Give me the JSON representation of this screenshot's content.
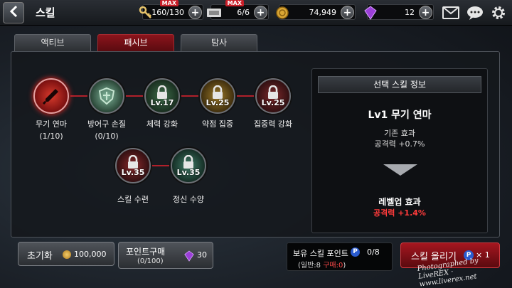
{
  "header": {
    "title": "스킬",
    "resources": [
      {
        "icon": "key-icon",
        "value": "160/130",
        "badge": "MAX"
      },
      {
        "icon": "ticket-icon",
        "value": "6/6",
        "badge": "MAX"
      },
      {
        "icon": "gold-coin-icon",
        "value": "74,949"
      },
      {
        "icon": "purple-gem-icon",
        "value": "12"
      }
    ]
  },
  "tabs": [
    "액티브",
    "패시브",
    "탐사"
  ],
  "active_tab": "패시브",
  "skills": [
    {
      "name": "무기 연마",
      "level": "(1/10)",
      "locked": false,
      "color": "#b3201f"
    },
    {
      "name": "방어구 손질",
      "level": "(0/10)",
      "locked": false,
      "color": "#3e6b4e"
    },
    {
      "name": "체력 강화",
      "lock_level": "Lv.17",
      "locked": true,
      "color": "#2f5c3b"
    },
    {
      "name": "약점 집중",
      "lock_level": "Lv.25",
      "locked": true,
      "color": "#7a5a1c"
    },
    {
      "name": "집중력 강화",
      "lock_level": "Lv.25",
      "locked": true,
      "color": "#6a1f22"
    },
    {
      "name": "스킬 수련",
      "lock_level": "Lv.35",
      "locked": true,
      "color": "#6a1f22"
    },
    {
      "name": "정신 수양",
      "lock_level": "Lv.35",
      "locked": true,
      "color": "#2a5a48"
    }
  ],
  "info": {
    "header": "선택 스킬 정보",
    "skill_name": "Lv1 무기 연마",
    "current_label": "기존 효과",
    "current_value": "공격력 +0.7%",
    "next_label": "레벨업 효과",
    "next_value": "공격력 +1.4%"
  },
  "bottom": {
    "reset_label": "초기화",
    "reset_cost": "100,000",
    "buy_label": "포인트구매",
    "buy_sub": "(0/100)",
    "buy_cost": "30",
    "owned_label": "보유 스킬 포인트",
    "owned_icon_text": "P",
    "owned_count": "0/8",
    "owned_sub_prefix": "(일반:8 ",
    "owned_sub_red": "구매:0",
    "owned_sub_suffix": ")",
    "upgrade_label": "스킬 올리기",
    "upgrade_mult": "× 1"
  },
  "watermark": "Photographed by LiveREX · www.liverex.net",
  "colors": {
    "accent_red": "#a5161f",
    "effect_red": "#ff3b3b",
    "point_blue": "#2a5bcf"
  }
}
